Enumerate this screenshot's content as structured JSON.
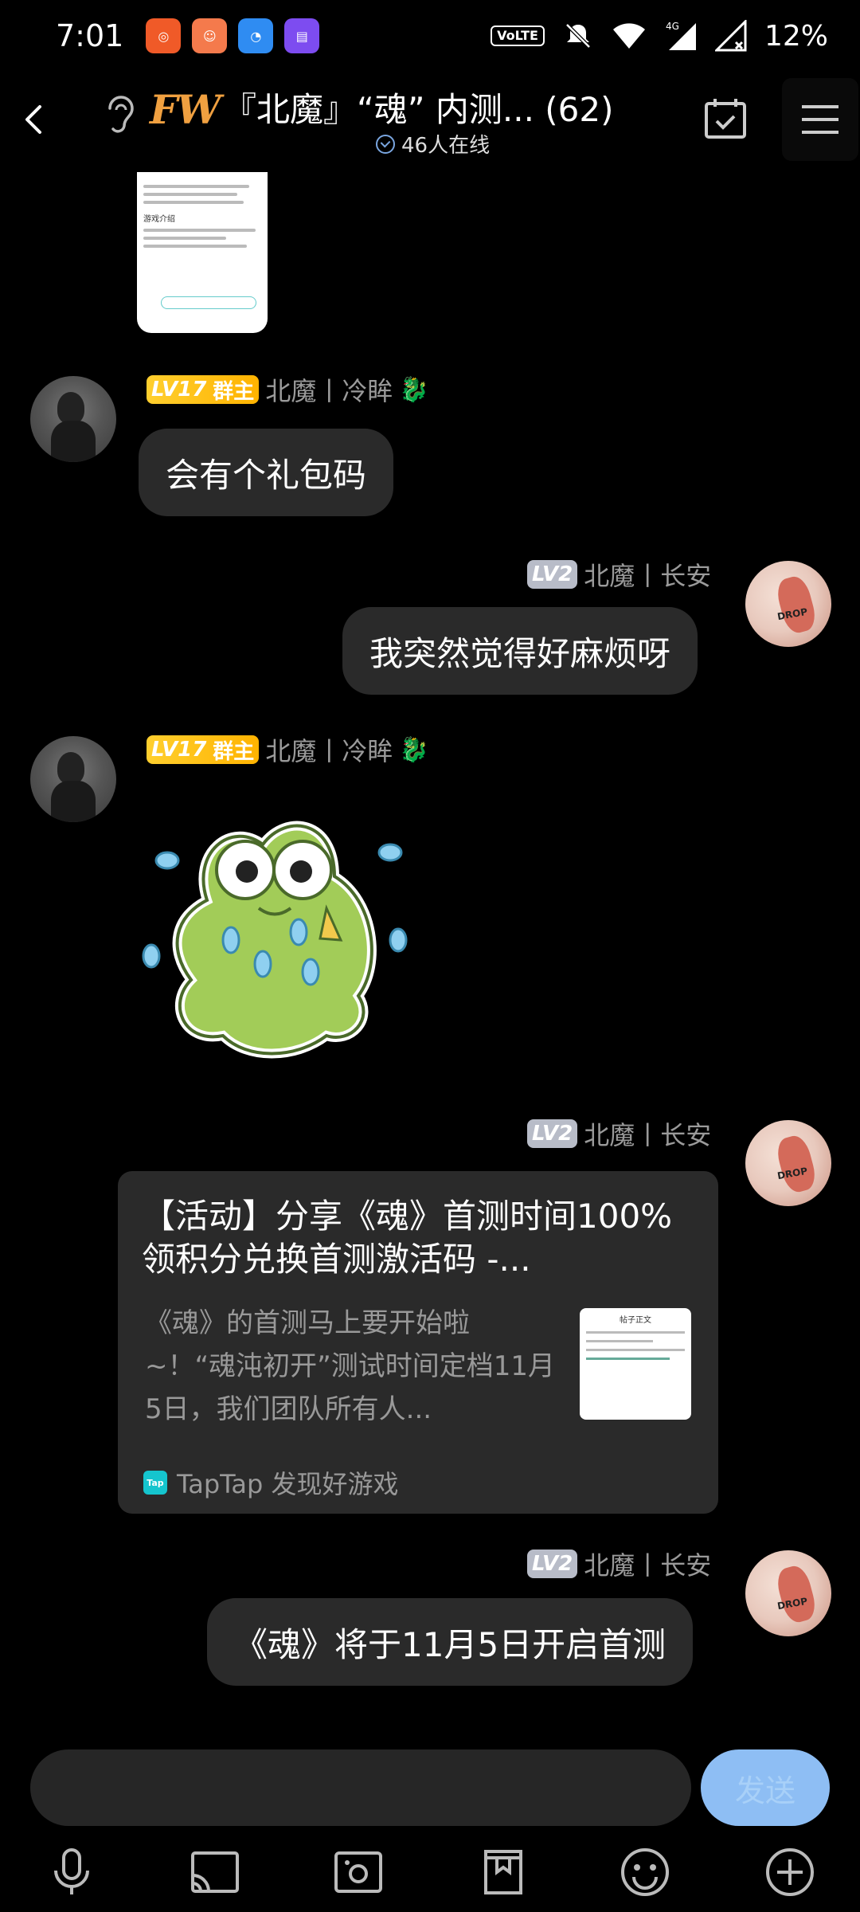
{
  "status_bar": {
    "time": "7:01",
    "battery": "12%",
    "volte": "VoLTE"
  },
  "header": {
    "logo_text": "FW",
    "title": "『北魔』“魂” 内测... (62)",
    "online": "46人在线"
  },
  "messages": [
    {
      "type": "text",
      "sender": "北魔丨冷眸",
      "level": "LV17",
      "role": "群主",
      "badge_emoji": "🐉",
      "text": "会有个礼包码"
    },
    {
      "type": "text",
      "sender": "北魔丨长安",
      "level": "LV2",
      "text": "我突然觉得好麻烦呀"
    },
    {
      "type": "sticker",
      "sender": "北魔丨冷眸",
      "level": "LV17",
      "role": "群主",
      "badge_emoji": "🐉",
      "sticker": "crying-frog"
    },
    {
      "type": "link",
      "sender": "北魔丨长安",
      "level": "LV2",
      "card_title": "【活动】分享《魂》首测时间100%领积分兑换首测激活码 -...",
      "card_desc": "《魂》的首测马上要开始啦~！“魂沌初开”测试时间定档11月5日，我们团队所有人...",
      "card_thumb_title": "帖子正文",
      "source": "TapTap 发现好游戏",
      "source_icon": "Tap"
    },
    {
      "type": "text",
      "sender": "北魔丨长安",
      "level": "LV2",
      "text": "《魂》将于11月5日开启首测"
    }
  ],
  "thumbnail_top": {
    "section_title": "游戏介绍"
  },
  "input": {
    "placeholder": "",
    "send_label": "发送"
  },
  "toolbar": {
    "icons": [
      "microphone-icon",
      "cast-icon",
      "photo-icon",
      "gift-box-icon",
      "emoji-icon",
      "plus-icon"
    ]
  },
  "colors": {
    "bubble": "#2a2a2a",
    "lv17_badge": "#ffc21a",
    "lv2_badge": "#b8bcc8",
    "send_button": "#8ebef4"
  }
}
